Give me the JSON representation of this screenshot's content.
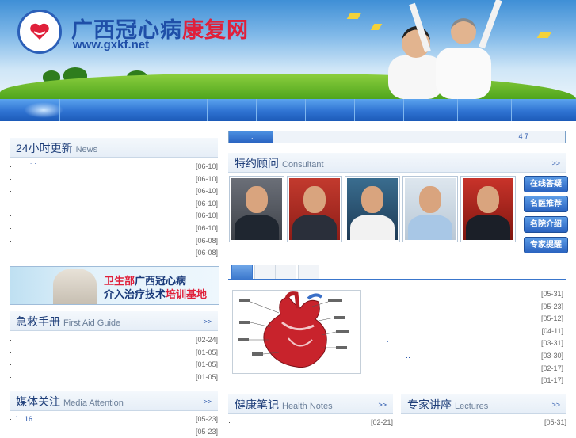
{
  "site": {
    "title_blue": "广西冠心病",
    "title_red": "康复网",
    "url": "www.gxkf.net"
  },
  "news": {
    "title_cn": "24小时更新",
    "title_en": "News",
    "items": [
      {
        "text": "˙ ˙",
        "date": "[06-10]"
      },
      {
        "text": "",
        "date": "[06-10]"
      },
      {
        "text": "",
        "date": "[06-10]"
      },
      {
        "text": "",
        "date": "[06-10]"
      },
      {
        "text": "",
        "date": "[06-10]"
      },
      {
        "text": "",
        "date": "[06-10]"
      },
      {
        "text": "",
        "date": "[06-08]"
      },
      {
        "text": "",
        "date": "[06-08]"
      }
    ]
  },
  "banner": {
    "line1_red": "卫生部",
    "line1_blue": "广西冠心病",
    "line2_blue": "介入治疗技术",
    "line2_red": "培训基地"
  },
  "first_aid": {
    "title_cn": "急救手册",
    "title_en": "First Aid Guide",
    "more": ">>",
    "items": [
      {
        "text": "",
        "date": "[02-24]"
      },
      {
        "text": "",
        "date": "[01-05]"
      },
      {
        "text": "",
        "date": "[01-05]"
      },
      {
        "text": "",
        "date": "[01-05]"
      }
    ]
  },
  "media": {
    "title_cn": "媒体关注",
    "title_en": "Media Attention",
    "more": ">>",
    "items": [
      {
        "text": "˙ ˙ 16",
        "date": "[05-23]"
      },
      {
        "text": "",
        "date": "[05-23]"
      }
    ]
  },
  "progress": {
    "label": ":",
    "number": "4 7",
    "fraction": 0.13
  },
  "consultant": {
    "title_cn": "特约顾问",
    "title_en": "Consultant",
    "more": ">>"
  },
  "side_buttons": [
    "在线答疑",
    "名医推荐",
    "名院介绍",
    "专家提醒"
  ],
  "articles": {
    "items": [
      {
        "text": "",
        "date": "[05-31]"
      },
      {
        "text": "",
        "date": "[05-23]"
      },
      {
        "text": "",
        "date": "[05-12]"
      },
      {
        "text": "",
        "date": "[04-11]"
      },
      {
        "text": ":",
        "date": "[03-31]"
      },
      {
        "text": "‥",
        "date": "[03-30]"
      },
      {
        "text": "",
        "date": "[02-17]"
      },
      {
        "text": "",
        "date": "[01-17]"
      }
    ]
  },
  "health_notes": {
    "title_cn": "健康笔记",
    "title_en": "Health Notes",
    "more": ">>",
    "items": [
      {
        "text": "",
        "date": "[02-21]"
      }
    ]
  },
  "lectures": {
    "title_cn": "专家讲座",
    "title_en": "Lectures",
    "more": ">>",
    "items": [
      {
        "text": "",
        "date": "[05-31]"
      }
    ]
  },
  "colors": {
    "brand_blue": "#1f4fa8",
    "brand_red": "#e0203a",
    "nav_blue": "#2f73d2"
  }
}
